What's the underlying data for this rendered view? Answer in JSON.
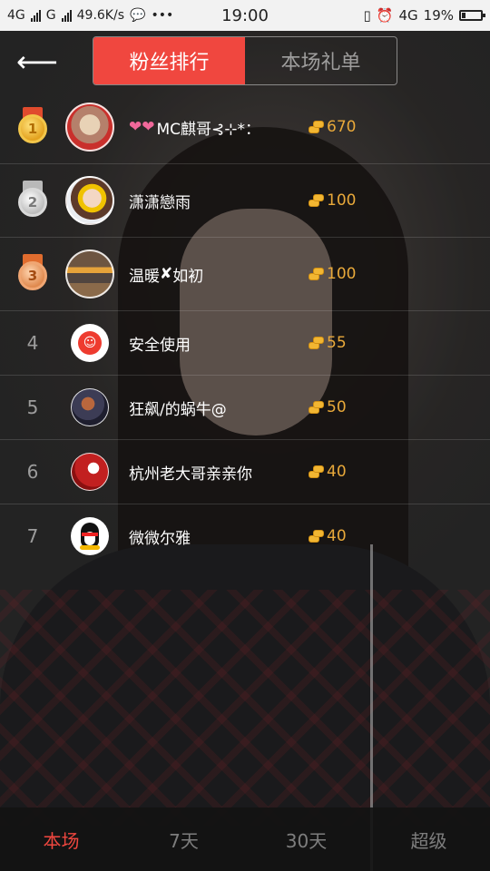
{
  "status_bar": {
    "net1": "4G",
    "net2": "G",
    "speed": "49.6K/s",
    "time": "19:00",
    "net3": "4G",
    "battery": "19%",
    "battery_level": 0.19,
    "icons": [
      "signal-icon",
      "chat-bubble-icon",
      "more-dots-icon",
      "vibrate-icon",
      "alarm-icon",
      "battery-icon"
    ]
  },
  "header": {
    "back_icon": "arrow-left-icon",
    "tabs": [
      {
        "label": "粉丝排行",
        "active": true
      },
      {
        "label": "本场礼单",
        "active": false
      }
    ]
  },
  "ranking": [
    {
      "rank": "1",
      "medal": "gold",
      "name": "MC麒哥⊰⊹*：",
      "hearts": "❤❤",
      "score": "670"
    },
    {
      "rank": "2",
      "medal": "silver",
      "name": "潇潇戀雨",
      "score": "100"
    },
    {
      "rank": "3",
      "medal": "bronze",
      "name_a": "温暖",
      "name_mark": "✘",
      "name_b": "如初",
      "score": "100"
    },
    {
      "rank": "4",
      "name": "安全使用",
      "score": "55"
    },
    {
      "rank": "5",
      "name": "狂飙/的蜗牛@",
      "score": "50"
    },
    {
      "rank": "6",
      "name": "杭州老大哥亲亲你",
      "score": "40"
    },
    {
      "rank": "7",
      "name": "微微尔雅",
      "score": "40"
    }
  ],
  "bottom_tabs": [
    {
      "label": "本场",
      "active": true
    },
    {
      "label": "7天",
      "active": false
    },
    {
      "label": "30天",
      "active": false
    },
    {
      "label": "超级",
      "active": false
    }
  ],
  "colors": {
    "accent": "#f0473f",
    "score": "#e9a93a"
  }
}
